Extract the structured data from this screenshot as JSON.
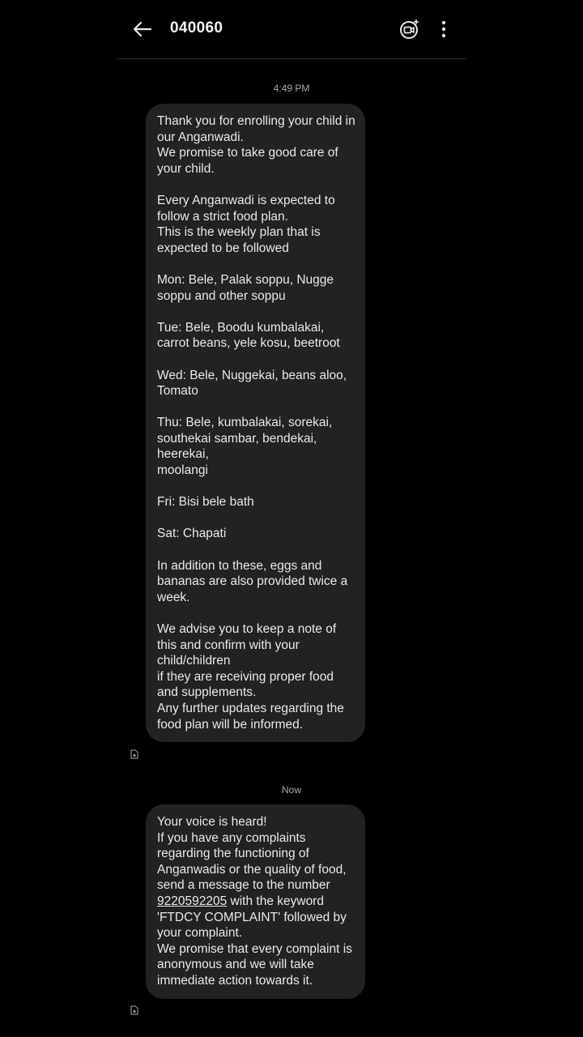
{
  "header": {
    "contact": "040060"
  },
  "icons": {
    "back": "arrow-left-icon",
    "video": "video-call-icon",
    "more": "more-vert-icon",
    "sim": "sim-card-icon"
  },
  "messages": [
    {
      "time": "4:49 PM",
      "text": "Thank you for enrolling your child in our Anganwadi.\nWe promise to take good care of your child.\n\nEvery Anganwadi is expected to follow a strict food plan.\nThis is the weekly plan that is expected to be followed\n\nMon: Bele, Palak soppu, Nugge soppu and other soppu\n\nTue: Bele, Boodu kumbalakai, carrot beans, yele kosu, beetroot\n\nWed: Bele, Nuggekai, beans aloo, Tomato\n\nThu: Bele, kumbalakai, sorekai, southekai sambar, bendekai, heerekai,\nmoolangi\n\nFri: Bisi bele bath\n\nSat: Chapati\n\nIn addition to these, eggs and bananas are also provided twice a week.\n\nWe advise you to keep a note of this and confirm with your child/children\nif they are receiving proper food and supplements.\nAny further updates regarding the food plan will be informed."
    },
    {
      "time": "Now",
      "text_before": "Your voice is heard!\nIf you have any complaints regarding the functioning of Anganwadis or the quality of food, send a message to the number ",
      "number": "9220592205",
      "text_after": " with the keyword 'FTDCY COMPLAINT' followed by your complaint.\nWe promise that every complaint is anonymous and we will take immediate action towards it."
    }
  ]
}
